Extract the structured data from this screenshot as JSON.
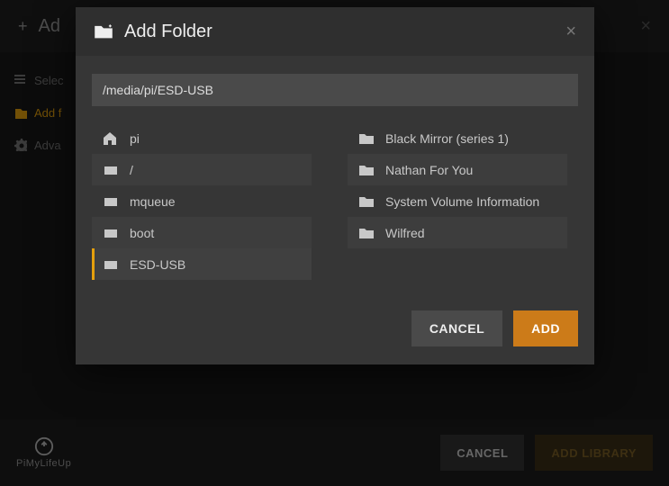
{
  "bg": {
    "header_title": "Ad",
    "sidebar": {
      "select": "Selec",
      "add_folders": "Add f",
      "advanced": "Adva"
    },
    "footer": {
      "logo_text": "PiMyLifeUp",
      "cancel": "CANCEL",
      "add_library": "ADD LIBRARY"
    }
  },
  "modal": {
    "title": "Add Folder",
    "path": "/media/pi/ESD-USB",
    "drives": [
      {
        "name": "pi",
        "icon": "home",
        "shade": false,
        "selected": false
      },
      {
        "name": "/",
        "icon": "drive",
        "shade": true,
        "selected": false
      },
      {
        "name": "mqueue",
        "icon": "drive",
        "shade": false,
        "selected": false
      },
      {
        "name": "boot",
        "icon": "drive",
        "shade": true,
        "selected": false
      },
      {
        "name": "ESD-USB",
        "icon": "drive",
        "shade": false,
        "selected": true
      }
    ],
    "folders": [
      {
        "name": "Black Mirror (series 1)",
        "shade": false
      },
      {
        "name": "Nathan For You",
        "shade": true
      },
      {
        "name": "System Volume Information",
        "shade": false
      },
      {
        "name": "Wilfred",
        "shade": true
      }
    ],
    "buttons": {
      "cancel": "CANCEL",
      "add": "ADD"
    }
  }
}
